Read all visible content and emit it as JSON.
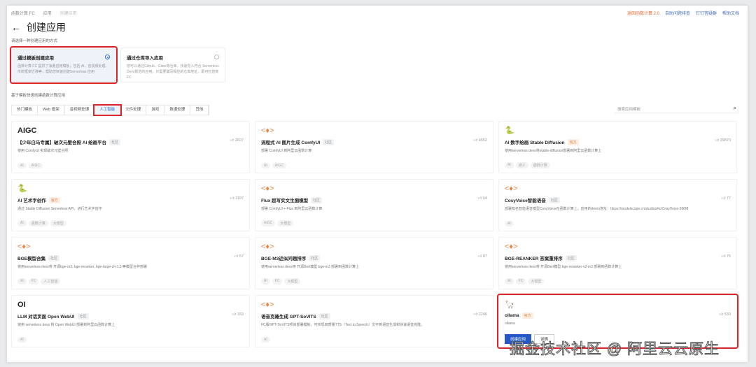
{
  "breadcrumb": [
    "函数计算 FC",
    "应用",
    "创建应用"
  ],
  "top_links": [
    "返回函数计算 2.0",
    "自助问题排查",
    "钉钉答疑群",
    "帮助文档"
  ],
  "title": "创建应用",
  "subtitle": "请选择一种创建应用的方式",
  "options": [
    {
      "title": "通过模板创建应用",
      "desc": "函数计算 FC 提供了海量应用模板，包括 AI、音视频处理、传统框架迁移等，帮助您快速创建Serverless 应用",
      "selected": true
    },
    {
      "title": "通过仓库导入应用",
      "desc": "您可以通过Github、Gitee等仓库，快速导入符合 Serverless Devs规范的应用，只需要填写相应的仓库地址，即可托管到 FC",
      "selected": false
    }
  ],
  "section_label": "基于模板快速创建函数计算应用",
  "tabs": [
    "热门模板",
    "Web 框架",
    "音视频处理",
    "人工智能",
    "文件处理",
    "游戏",
    "数据处理",
    "其他"
  ],
  "active_tab": "人工智能",
  "search": {
    "placeholder": "搜索应用模板"
  },
  "cards": [
    {
      "logo": "AIGC",
      "logo_type": "bold",
      "name": "【少年白马专属】破次元壁合照 AI 绘画平台",
      "badge": "社区",
      "likes": "2607",
      "desc": "使用 ComfyUI 实现破次元壁合照",
      "tags": [
        "AI",
        "AIGC"
      ]
    },
    {
      "logo": "<♦>",
      "logo_type": "orange",
      "name": "流程式 AI 图片生成 ComfyUI",
      "badge": "社区",
      "likes": "4552",
      "desc": "部署 ComfyUI 到阿里云函数计算",
      "tags": [
        "AI",
        "AIGC"
      ]
    },
    {
      "logo": "🐍",
      "logo_type": "py",
      "name": "AI 数字绘画 Stable Diffusion",
      "badge": "官方",
      "likes": "29870",
      "desc": "使用serverless devs将stable-diffusion部署到阿里云函数计算上",
      "tags": [
        "AI",
        "通义",
        "函数计算"
      ]
    },
    {
      "logo": "🐍",
      "logo_type": "py",
      "name": "AI 艺术字创作",
      "badge": "官方",
      "likes": "1197",
      "desc": "通过 Stable Diffusion Serverless API，进行艺术字创作",
      "tags": [
        "AI",
        "函数计算",
        "大模型"
      ]
    },
    {
      "logo": "<♦>",
      "logo_type": "orange",
      "name": "Flux 超写实文生图模型",
      "badge": "社区",
      "likes": "64",
      "desc": "部署 ComfyUI + Flux 到阿里云函数计算",
      "tags": [
        "AIGC",
        "大模型"
      ]
    },
    {
      "logo": "<♦>",
      "logo_type": "orange",
      "name": "CosyVoice智能语音",
      "badge": "社区",
      "likes": "77",
      "desc": "部署知名智能语音模型CosyVoice在函数计算上，应用的demo地址：https://modelscope.cn/studios/iic/CosyVoice-300M",
      "tags": [
        "AI"
      ]
    },
    {
      "logo": "<♦>",
      "logo_type": "orange",
      "name": "BGE模型合集",
      "badge": "社区",
      "likes": "57",
      "desc": "使用serverless devs将 开源bge-m3, bge-reranker, bge-large-zh-1.5 等模型合并部署",
      "tags": [
        "AI",
        "FC",
        "人工智能"
      ]
    },
    {
      "logo": "<♦>",
      "logo_type": "orange",
      "name": "BGE-M3近似问题排序",
      "badge": "社区",
      "likes": "87",
      "desc": "使用serverless devs将 开源Bert模型 bge-m3 部署到函数计算上",
      "tags": [
        "AI",
        "FC",
        "大模型"
      ]
    },
    {
      "logo": "<♦>",
      "logo_type": "orange",
      "name": "BGE-REANKER 答案重排序",
      "badge": "社区",
      "likes": "75",
      "desc": "使用serverless devs将 开源Bert模型 bge-reranker-v2-m3 部署到函数计算上",
      "tags": [
        "AI",
        "FC",
        "大模型"
      ]
    },
    {
      "logo": "OI",
      "logo_type": "bold",
      "name": "LLM 对话页面 Open WebUI",
      "badge": "社区",
      "likes": "333",
      "desc": "使用 serverless devs 将 Open WebUI 部署到阿里云函数计算上",
      "tags": [
        "AI"
      ]
    },
    {
      "logo": "<♦>",
      "logo_type": "orange",
      "name": "语音克隆生成 GPT-SoVITS",
      "badge": "社区",
      "likes": "2246",
      "desc": "FC版GPT-SoVITS项目部署模板，可实现高质量TTS（Text to Speech）文字到语音生成和快速语音克隆。",
      "tags": [
        "AI"
      ]
    },
    {
      "logo": "🦙",
      "logo_type": "bold",
      "name": "ollama",
      "badge": "官方",
      "likes": "530",
      "desc": "ollama",
      "tags": [],
      "buttons": [
        "创建应用",
        "详情"
      ],
      "highlight": true
    }
  ],
  "watermark": "掘金技术社区 @ 阿里云云原生"
}
